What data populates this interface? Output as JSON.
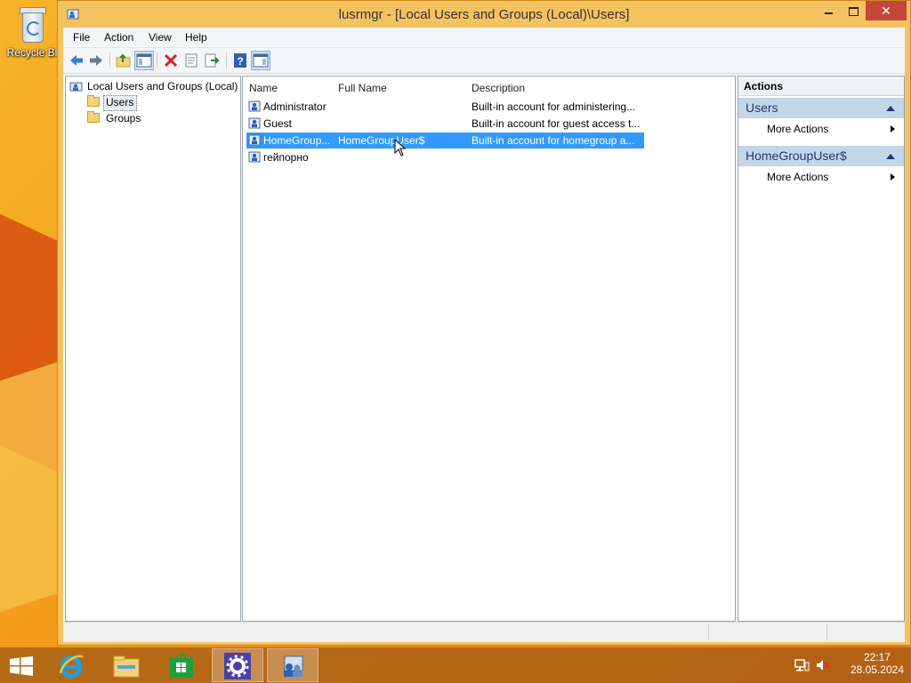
{
  "desktop": {
    "recycle_bin_label": "Recycle Bi"
  },
  "window": {
    "title": "lusrmgr - [Local Users and Groups (Local)\\Users]",
    "close_glyph": "✕"
  },
  "menu": {
    "file": "File",
    "action": "Action",
    "view": "View",
    "help": "Help"
  },
  "toolbar": {
    "icons": [
      "back-arrow-icon",
      "forward-arrow-icon",
      "up-folder-icon",
      "show-hide-console-tree-icon",
      "delete-icon",
      "properties-icon",
      "export-list-icon",
      "help-icon",
      "show-hide-action-pane-icon"
    ]
  },
  "tree": {
    "root": "Local Users and Groups (Local)",
    "users": "Users",
    "groups": "Groups"
  },
  "list": {
    "columns": {
      "name": "Name",
      "full_name": "Full Name",
      "description": "Description"
    },
    "rows": [
      {
        "name": "Administrator",
        "full_name": "",
        "description": "Built-in account for administering..."
      },
      {
        "name": "Guest",
        "full_name": "",
        "description": "Built-in account for guest access t..."
      },
      {
        "name": "HomeGroup...",
        "full_name": "HomeGroupUser$",
        "description": "Built-in account for homegroup a..."
      },
      {
        "name": "гейпорно",
        "full_name": "",
        "description": ""
      }
    ],
    "selected_index": 2
  },
  "actions": {
    "header": "Actions",
    "section1_title": "Users",
    "section1_more": "More Actions",
    "section2_title": "HomeGroupUser$",
    "section2_more": "More Actions"
  },
  "taskbar": {
    "apps": [
      "internet-explorer-icon",
      "file-explorer-icon",
      "store-icon",
      "settings-icon",
      "lusrmgr-icon"
    ],
    "time": "22:17",
    "date": "28.05.2024"
  },
  "colors": {
    "selection": "#3399ff",
    "action_section": "#c3d6ea",
    "close_button": "#c7463a"
  }
}
